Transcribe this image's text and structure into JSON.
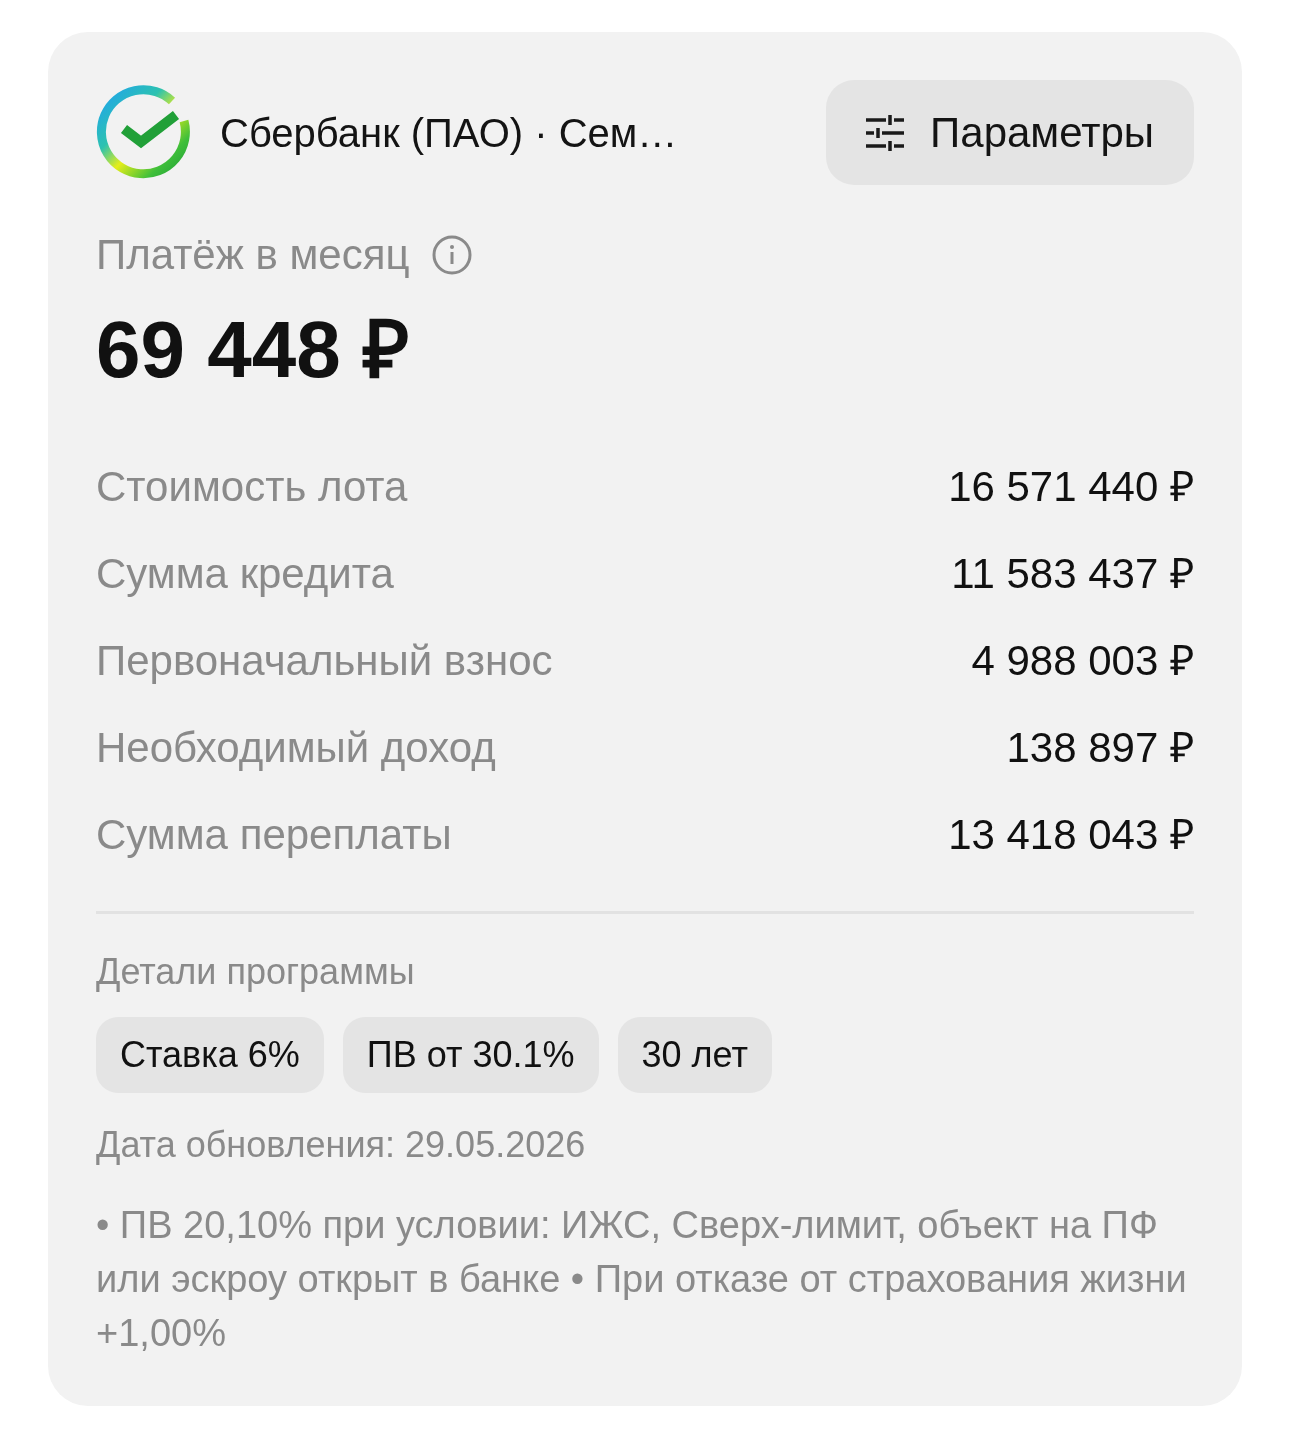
{
  "header": {
    "title": "Сбербанк (ПАО) · Сем…",
    "button": {
      "label": "Параметры"
    }
  },
  "payment": {
    "label": "Платёж в месяц",
    "amount": "69 448 ₽"
  },
  "rows": [
    {
      "label": "Стоимость лота",
      "value": "16 571 440 ₽"
    },
    {
      "label": "Сумма кредита",
      "value": "11 583 437 ₽"
    },
    {
      "label": "Первоначальный взнос",
      "value": "4 988 003 ₽"
    },
    {
      "label": "Необходимый доход",
      "value": "138 897 ₽"
    },
    {
      "label": "Сумма переплаты",
      "value": "13 418 043 ₽"
    }
  ],
  "details": {
    "title": "Детали программы",
    "chips": [
      "Ставка 6%",
      "ПВ от 30.1%",
      "30 лет"
    ],
    "updated": "Дата обновления: 29.05.2026",
    "note": "• ПВ 20,10% при условии: ИЖС, Сверх-лимит, объект на ПФ или эскроу открыт в банке • При отказе от страхования жизни +1,00%"
  }
}
